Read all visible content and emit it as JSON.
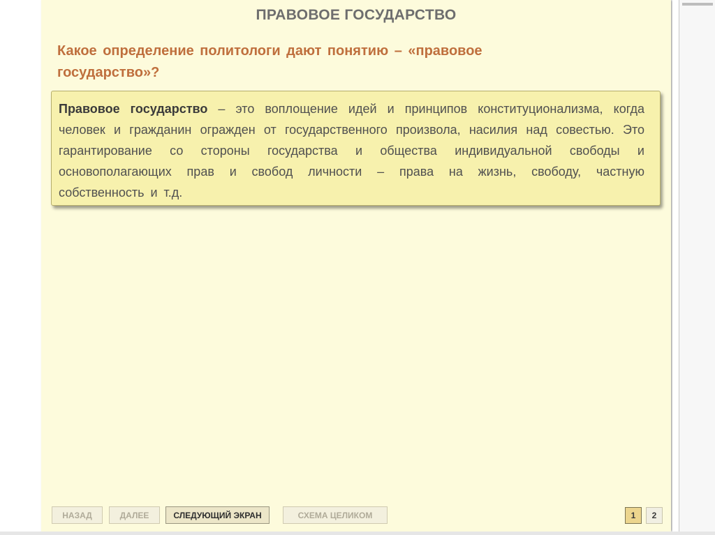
{
  "slide": {
    "title": "ПРАВОВОЕ ГОСУДАРСТВО",
    "question": "Какое определение политологи дают понятию – «правовое государство»?",
    "definition": {
      "term": "Правовое государство",
      "text": " – это воплощение идей и принципов конституционализма, когда человек и гражданин огражден от государственного произвола, насилия над совестью. Это гарантирование со стороны государства и общества индивидуальной свободы и основополагающих прав и свобод личности – права на жизнь, свободу, частную собственность и т.д."
    }
  },
  "navigation": {
    "back_label": "НАЗАД",
    "next_label": "ДАЛЕЕ",
    "next_screen_label": "СЛЕДУЮЩИЙ ЭКРАН",
    "full_scheme_label": "СХЕМА ЦЕЛИКОМ"
  },
  "pagination": {
    "current": "1",
    "pages": [
      "1",
      "2"
    ]
  },
  "colors": {
    "slide_background": "#fdfbdc",
    "definition_background": "#f7f1ad",
    "question_color": "#bf6f3d",
    "title_color": "#6e6e6e"
  }
}
